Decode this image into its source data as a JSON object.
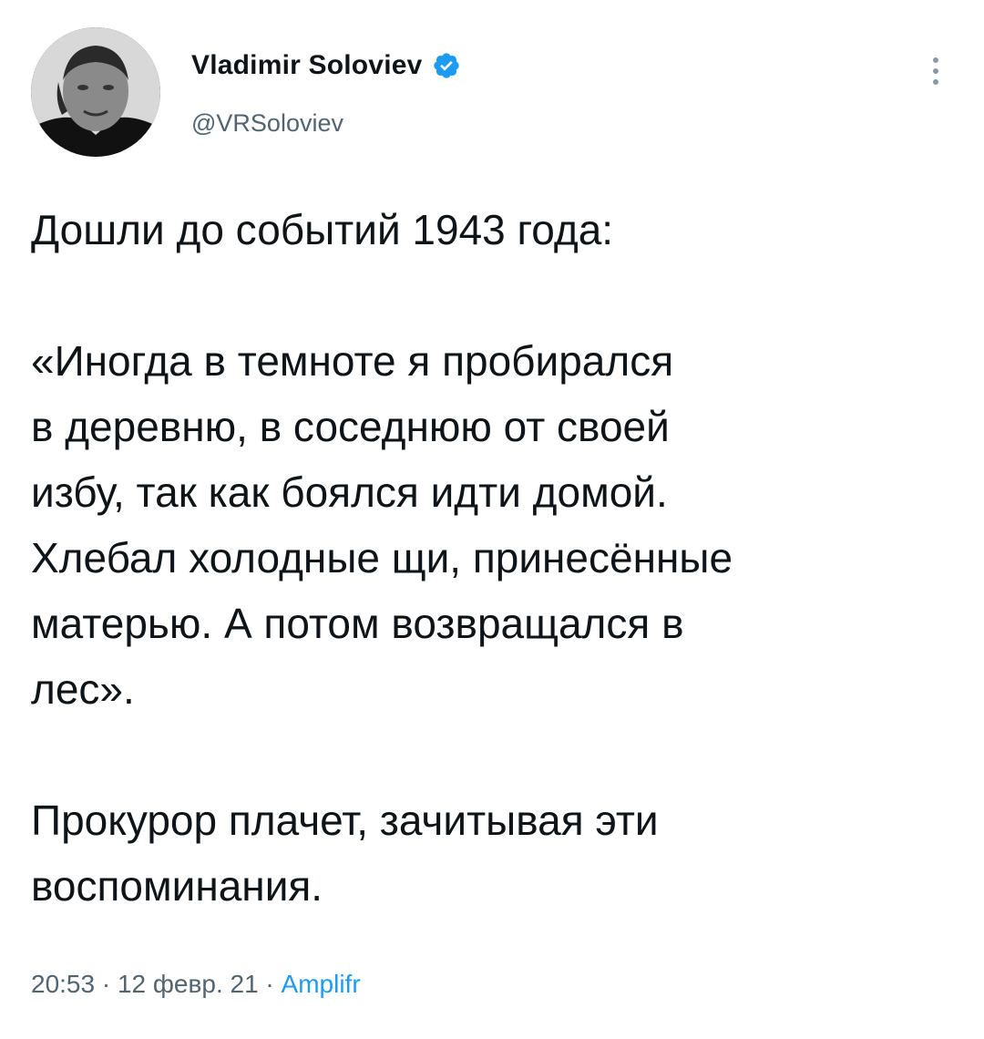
{
  "author": {
    "display_name": "Vladimir Soloviev",
    "handle": "@VRSoloviev",
    "verified_icon": "verified-badge-icon",
    "avatar_icon": "profile-photo"
  },
  "more_icon": "more-vertical-icon",
  "tweet": {
    "lines": [
      "Дошли до событий 1943 года:",
      "",
      "«Иногда в темноте я пробирался",
      "в деревню, в соседнюю от своей",
      "избу, так как боялся идти домой.",
      "Хлебал холодные щи, принесённые",
      "матерью. А потом возвращался в",
      "лес».",
      "",
      "Прокурор плачет, зачитывая эти",
      "воспоминания."
    ]
  },
  "meta": {
    "time": "20:53",
    "separator1": " · ",
    "date": "12 февр. 21",
    "separator2": " · ",
    "source": "Amplifr"
  },
  "colors": {
    "accent": "#1d9bf0",
    "text_primary": "#0f1419",
    "text_secondary": "#536471"
  }
}
